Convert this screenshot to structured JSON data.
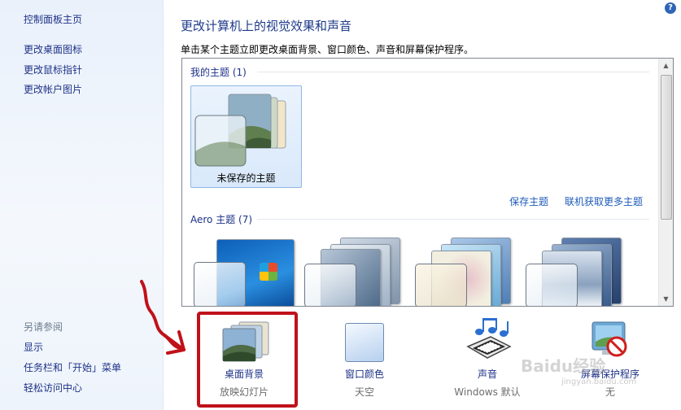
{
  "sidebar": {
    "links": [
      "控制面板主页",
      "更改桌面图标",
      "更改鼠标指针",
      "更改帐户图片"
    ],
    "see_also_heading": "另请参阅",
    "see_also": [
      "显示",
      "任务栏和「开始」菜单",
      "轻松访问中心"
    ]
  },
  "header": {
    "title": "更改计算机上的视觉效果和声音",
    "instruction": "单击某个主题立即更改桌面背景、窗口颜色、声音和屏幕保护程序。",
    "help_icon": "?"
  },
  "themes": {
    "my_themes_header": "我的主题 (1)",
    "unsaved_theme_label": "未保存的主题",
    "save_theme_link": "保存主题",
    "get_more_link": "联机获取更多主题",
    "aero_header": "Aero 主题 (7)"
  },
  "settings": [
    {
      "label": "桌面背景",
      "value": "放映幻灯片",
      "icon": "desktop-background-icon"
    },
    {
      "label": "窗口颜色",
      "value": "天空",
      "icon": "window-color-icon"
    },
    {
      "label": "声音",
      "value": "Windows 默认",
      "icon": "sound-icon"
    },
    {
      "label": "屏幕保护程序",
      "value": "无",
      "icon": "screensaver-icon"
    }
  ],
  "watermark": {
    "brand": "Baidu经验",
    "url": "jingyan.baidu.com"
  },
  "colors": {
    "link": "#1e3287",
    "annotation": "#c0111a",
    "selected_tile": "#d9e9fb"
  }
}
